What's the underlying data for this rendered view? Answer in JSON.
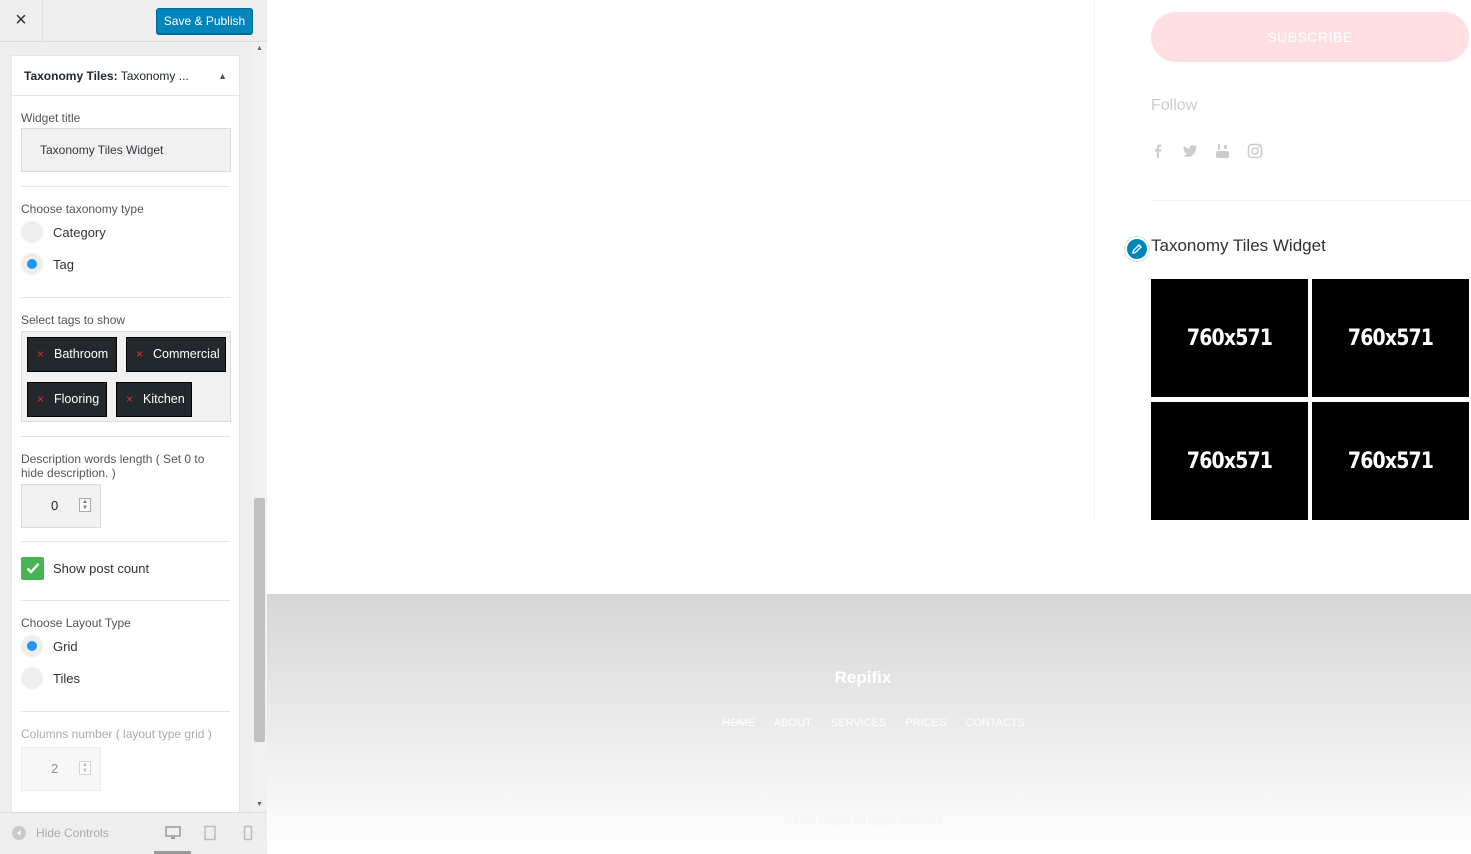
{
  "topbar": {
    "close_icon": "×",
    "publish_label": "Save & Publish"
  },
  "widget": {
    "header_bold": "Taxonomy Tiles:",
    "header_rest": " Taxonomy ...",
    "collapse_icon": "▲",
    "title_label": "Widget title",
    "title_value": "Taxonomy Tiles Widget",
    "taxonomy_label": "Choose taxonomy type",
    "taxonomy_options": [
      "Category",
      "Tag"
    ],
    "taxonomy_selected": "Tag",
    "tags_label": "Select tags to show",
    "tags": [
      "Bathroom",
      "Commercial",
      "Flooring",
      "Kitchen"
    ],
    "tag_remove_icon": "×",
    "desc_label": "Description words length ( Set 0 to hide description. )",
    "desc_value": "0",
    "post_count_label": "Show post count",
    "post_count_checked": true,
    "layout_label": "Choose Layout Type",
    "layout_options": [
      "Grid",
      "Tiles"
    ],
    "layout_selected": "Grid",
    "columns_label": "Columns number ( layout type grid )",
    "columns_value": "2"
  },
  "footer_controls": {
    "hide_label": "Hide Controls"
  },
  "preview": {
    "subscribe_label": "SUBSCRIBE",
    "follow_label": "Follow",
    "widget_title": "Taxonomy Tiles Widget",
    "tiles": [
      "760x571",
      "760x571",
      "760x571",
      "760x571"
    ],
    "site_name": "Repifix",
    "menu": [
      "HOME",
      "ABOUT",
      "SERVICES",
      "PRICES",
      "CONTACTS"
    ],
    "copyright": "© 2019 Repifix. All Rights Reserved"
  },
  "colors": {
    "accent": "#0085ba",
    "radio_on": "#2196f3",
    "check": "#46b450",
    "tag_bg": "#23282d",
    "subscribe": "#ffdfe2"
  }
}
